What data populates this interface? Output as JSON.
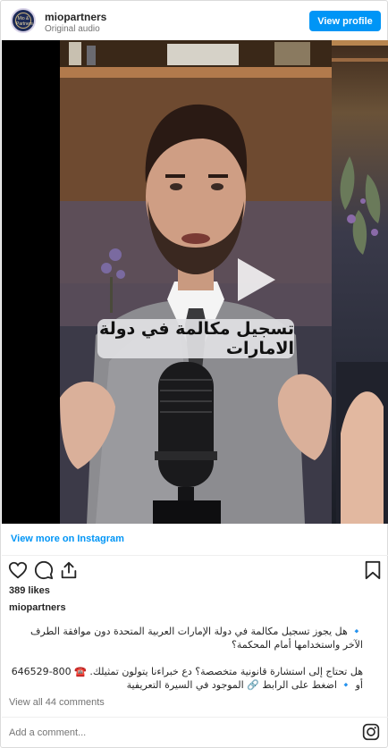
{
  "header": {
    "username": "miopartners",
    "subtitle": "Original audio",
    "view_profile_label": "View profile",
    "avatar_text": "Mio & Partners"
  },
  "video": {
    "caption": "تسجيل مكالمة في دولة الامارات"
  },
  "footer": {
    "view_more": "View more on Instagram",
    "likes": "389 likes",
    "caption_user": "miopartners",
    "post_line1": "🔹 هل يجوز تسجيل مكالمة في دولة الإمارات العربية المتحدة دون موافقة الطرف الآخر واستخدامها أمام المحكمة؟",
    "post_line2": "هل تحتاج إلى استشارة قانونية متخصصة؟ دع خبراءنا يتولون تمثيلك. ☎️ 800-646529 أو 🔹 اضغط على الرابط 🔗 الموجود في السيرة التعريفية",
    "view_comments": "View all 44 comments",
    "comment_placeholder": "Add a comment..."
  },
  "icons": [
    "heart-icon",
    "comment-icon",
    "share-icon",
    "bookmark-icon",
    "play-icon",
    "instagram-icon"
  ],
  "colors": {
    "accent": "#0095f6",
    "text": "#262626",
    "muted": "#737373"
  }
}
